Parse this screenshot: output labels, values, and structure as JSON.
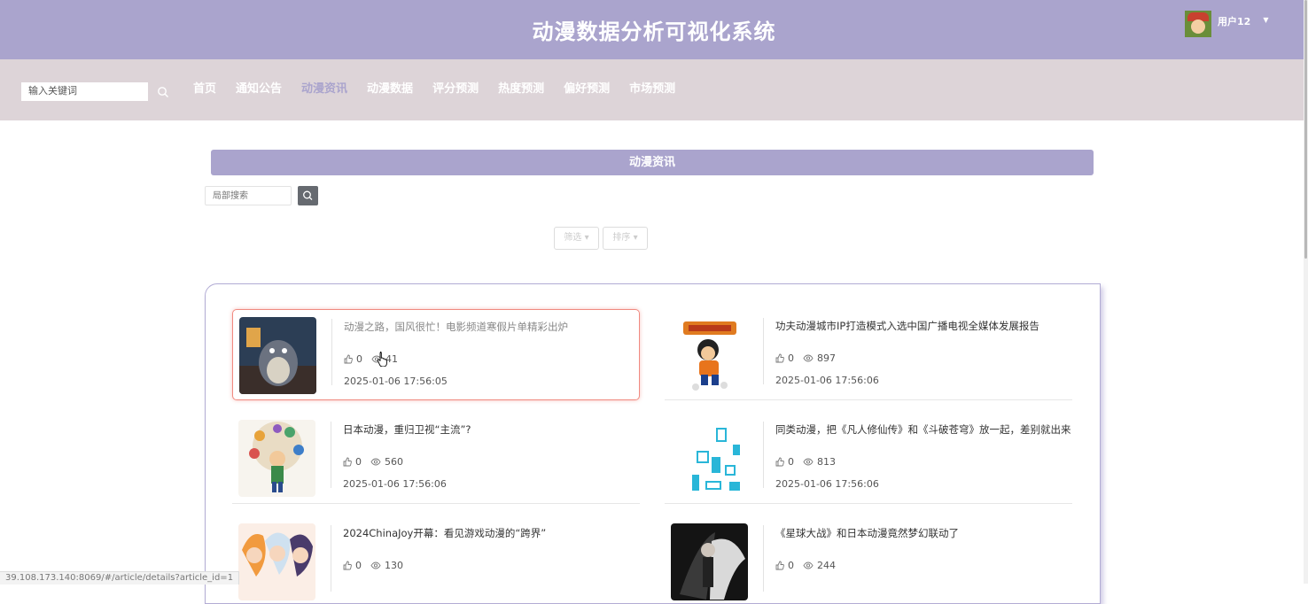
{
  "header": {
    "title": "动漫数据分析可视化系统",
    "username": "用户12"
  },
  "search": {
    "placeholder": "输入关键词"
  },
  "nav": [
    {
      "label": "首页",
      "active": false
    },
    {
      "label": "通知公告",
      "active": false
    },
    {
      "label": "动漫资讯",
      "active": true
    },
    {
      "label": "动漫数据",
      "active": false
    },
    {
      "label": "评分预测",
      "active": false
    },
    {
      "label": "热度预测",
      "active": false
    },
    {
      "label": "偏好预测",
      "active": false
    },
    {
      "label": "市场预测",
      "active": false
    }
  ],
  "section": {
    "title": "动漫资讯",
    "local_search_placeholder": "局部搜索"
  },
  "filters": {
    "filter_label": "筛选",
    "sort_label": "排序"
  },
  "articles": [
    {
      "title": "动漫之路，国风很忙！电影频道寒假片单精彩出炉",
      "likes": "0",
      "views": "41",
      "date": "2025-01-06 17:56:05"
    },
    {
      "title": "功夫动漫城市IP打造模式入选中国广播电视全媒体发展报告",
      "likes": "0",
      "views": "897",
      "date": "2025-01-06 17:56:06"
    },
    {
      "title": "日本动漫，重归卫视“主流”?",
      "likes": "0",
      "views": "560",
      "date": "2025-01-06 17:56:06"
    },
    {
      "title": "同类动漫，把《凡人修仙传》和《斗破苍穹》放一起，差别就出来",
      "likes": "0",
      "views": "813",
      "date": "2025-01-06 17:56:06"
    },
    {
      "title": "2024ChinaJoy开幕：看见游戏动漫的“跨界”",
      "likes": "0",
      "views": "130",
      "date": ""
    },
    {
      "title": "《星球大战》和日本动漫竟然梦幻联动了",
      "likes": "0",
      "views": "244",
      "date": ""
    }
  ],
  "status_url": "39.108.173.140:8069/#/article/details?article_id=1"
}
